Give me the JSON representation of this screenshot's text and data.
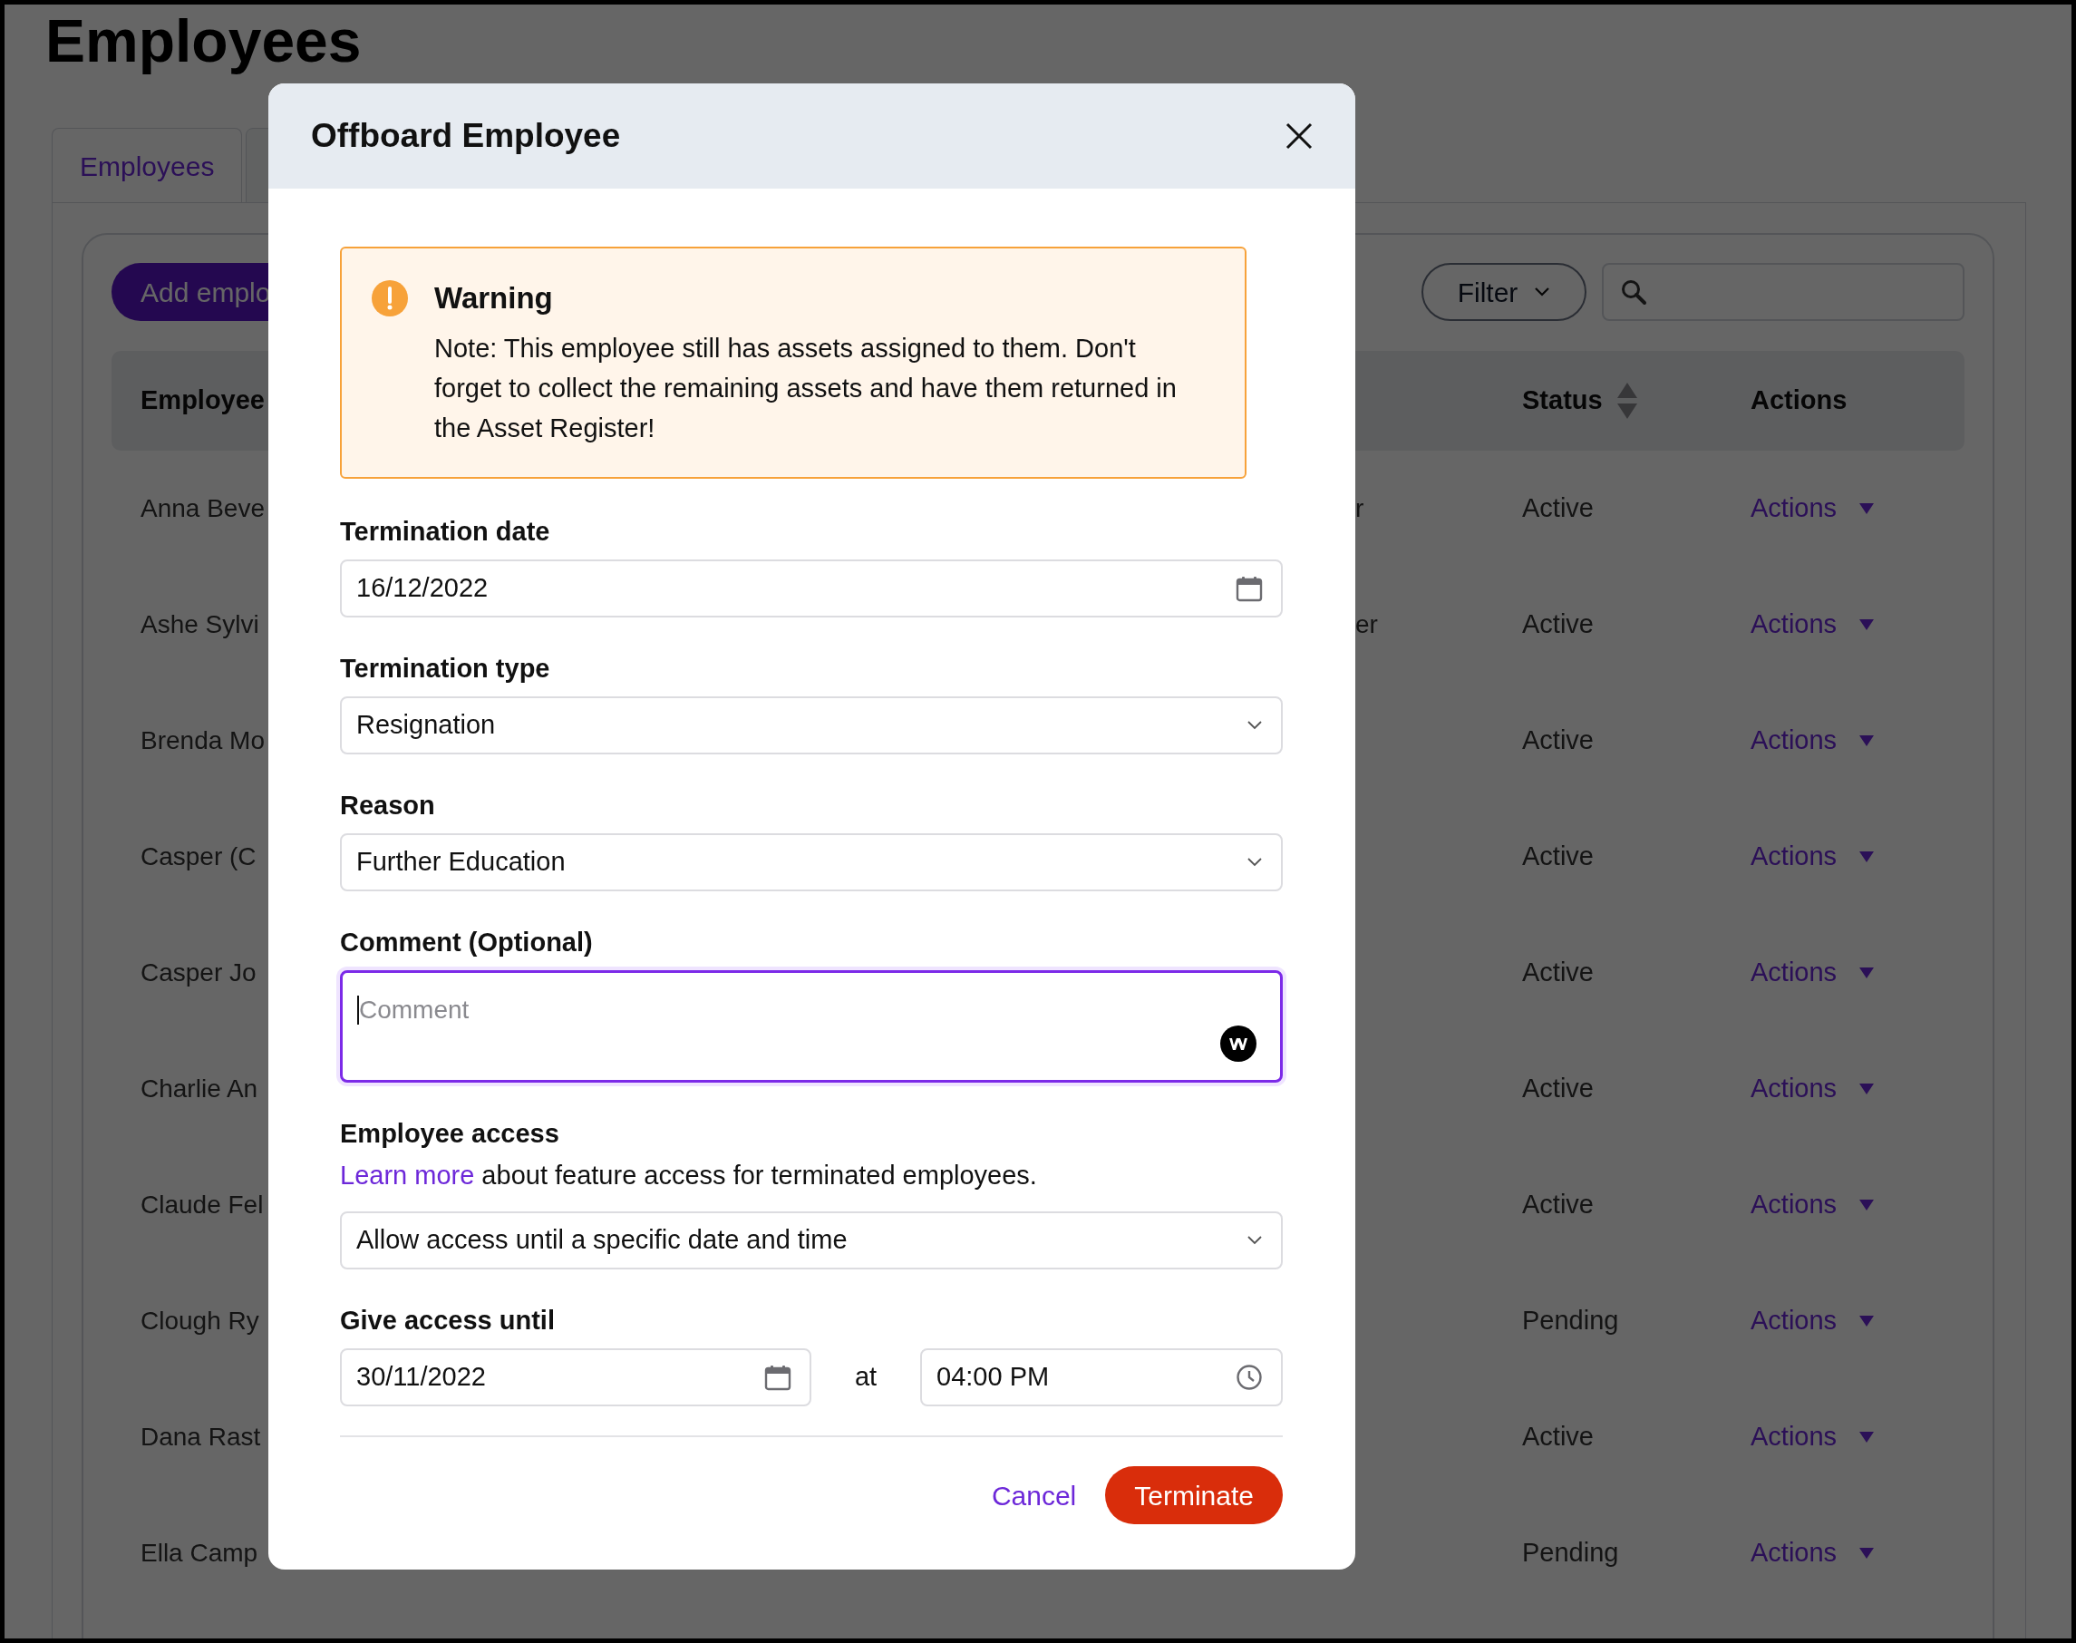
{
  "page": {
    "title": "Employees"
  },
  "tabs": [
    {
      "label": "Employees",
      "selected": true
    }
  ],
  "toolbar": {
    "add_button": "Add emplo",
    "filter": "Filter"
  },
  "table": {
    "columns": [
      {
        "label": "Employee",
        "sortable": false
      },
      {
        "label": "Status",
        "sortable": true
      },
      {
        "label": "Actions",
        "sortable": false
      }
    ],
    "rows": [
      {
        "name": "Anna Beve",
        "column_3": "r",
        "status": "Active",
        "action": "Actions"
      },
      {
        "name": "Ashe Sylvi",
        "column_3": "er",
        "status": "Active",
        "action": "Actions"
      },
      {
        "name": "Brenda Mo",
        "status": "Active",
        "action": "Actions"
      },
      {
        "name": "Casper (C",
        "status": "Active",
        "action": "Actions"
      },
      {
        "name": "Casper Jo",
        "status": "Active",
        "action": "Actions"
      },
      {
        "name": "Charlie An",
        "status": "Active",
        "action": "Actions"
      },
      {
        "name": "Claude Fel",
        "status": "Active",
        "action": "Actions"
      },
      {
        "name": "Clough Ry",
        "status": "Pending",
        "action": "Actions"
      },
      {
        "name": "Dana Rast",
        "status": "Active",
        "action": "Actions"
      },
      {
        "name": "Ella Camp",
        "status": "Pending",
        "action": "Actions"
      }
    ]
  },
  "modal": {
    "title": "Offboard Employee",
    "warning": {
      "title": "Warning",
      "message": "Note: This employee still has assets assigned to them. Don't forget to collect the remaining assets and have them returned in the Asset Register!"
    },
    "fields": [
      {
        "kind": "date",
        "label": "Termination date",
        "value": "16/12/2022"
      },
      {
        "kind": "select",
        "label": "Termination type",
        "value": "Resignation"
      },
      {
        "kind": "select",
        "label": "Reason",
        "value": "Further Education"
      },
      {
        "kind": "textarea",
        "label": "Comment (Optional)",
        "placeholder": "Comment",
        "focused": true
      }
    ],
    "access": {
      "label": "Employee access",
      "link": "Learn more",
      "description": "about feature access for terminated employees.",
      "option": "Allow access until a specific date and time"
    },
    "give_access": {
      "label": "Give access until",
      "date": "30/11/2022",
      "separator": "at",
      "time": "04:00 PM"
    },
    "buttons": {
      "cancel": "Cancel",
      "confirm": "Terminate"
    }
  }
}
